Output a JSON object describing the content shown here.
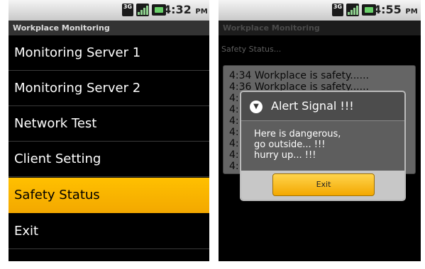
{
  "left_screen": {
    "status": {
      "network": "3G",
      "time": "4:32",
      "ampm": "PM"
    },
    "title": "Workplace Monitoring",
    "menu": [
      {
        "label": "Monitoring Server 1"
      },
      {
        "label": "Monitoring Server 2"
      },
      {
        "label": "Network Test"
      },
      {
        "label": "Client Setting"
      },
      {
        "label": "Safety Status",
        "selected": true
      },
      {
        "label": "Exit"
      }
    ]
  },
  "right_screen": {
    "status": {
      "network": "3G",
      "time": "4:55",
      "ampm": "PM"
    },
    "title": "Workplace Monitoring",
    "status_label": "Safety Status...",
    "log": [
      "4:34 Workplace is safety......",
      "4:36 Workplace is safety......",
      "4:",
      "4:",
      "4:",
      "4:",
      "4:",
      "4:",
      "4:"
    ],
    "dialog": {
      "title": "Alert Signal !!!",
      "icon": "alert-icon",
      "message": [
        "Here is dangerous,",
        "go outside... !!!",
        "hurry up... !!!"
      ],
      "button": "Exit"
    }
  },
  "colors": {
    "accent": "#f5b000",
    "titlebar": "#333333"
  }
}
